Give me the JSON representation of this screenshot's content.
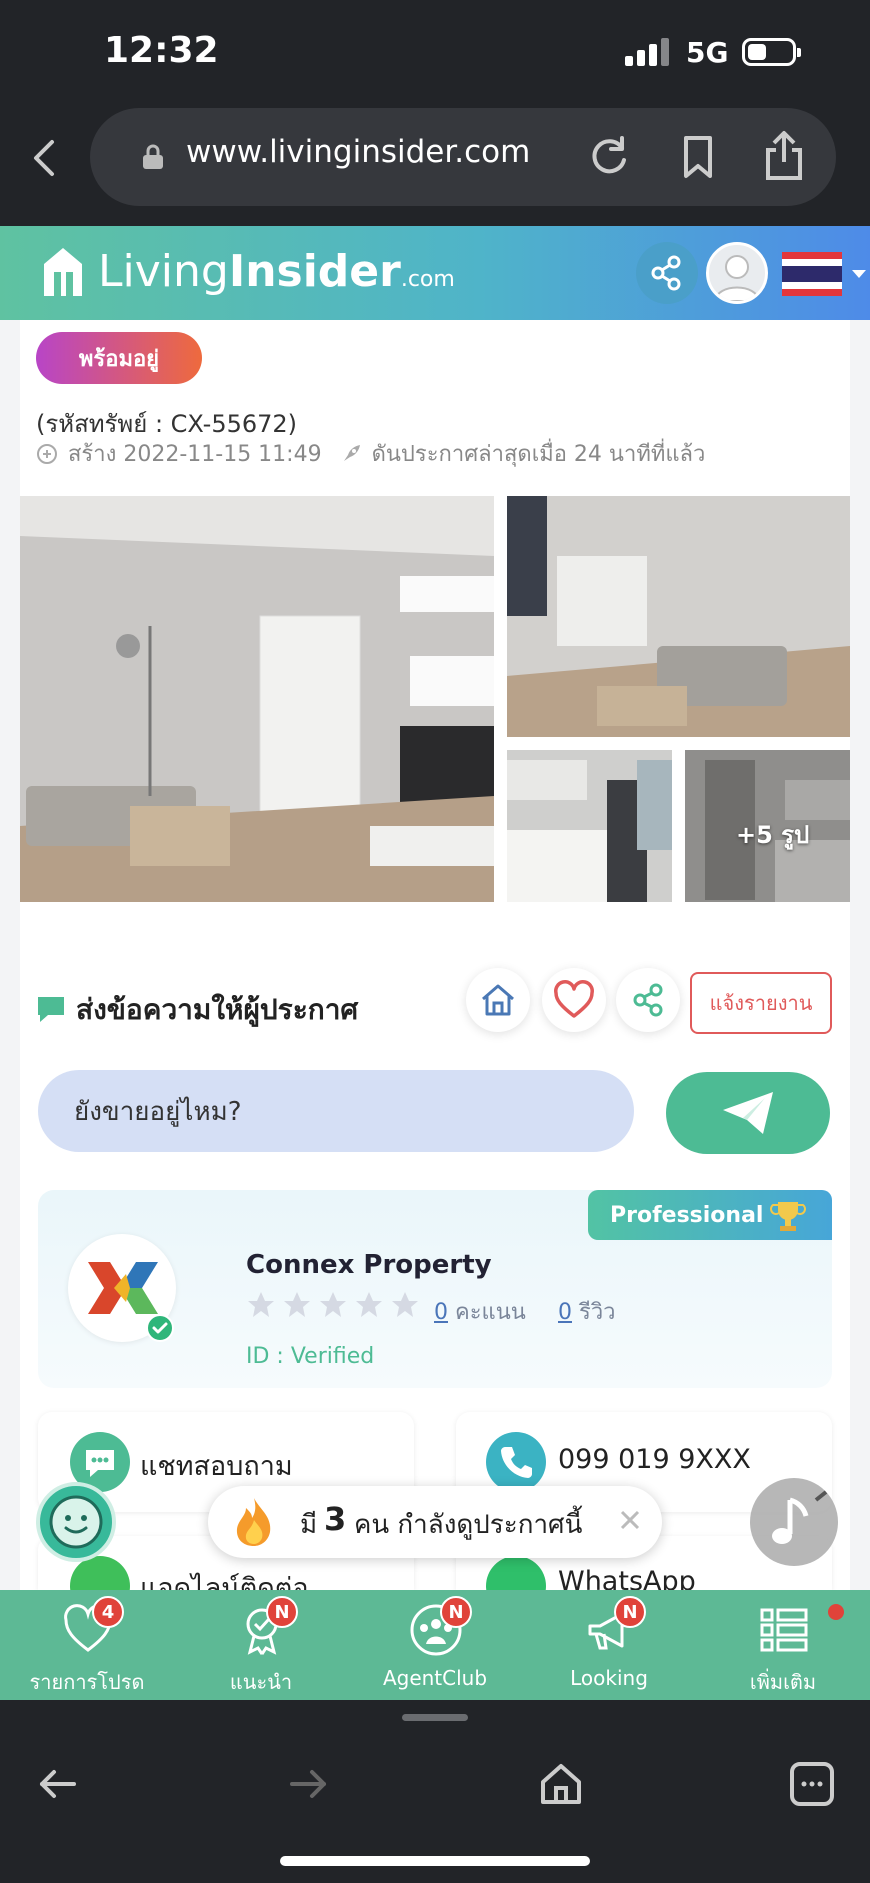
{
  "status": {
    "time": "12:32",
    "network": "5G"
  },
  "browser": {
    "url": "www.livinginsider.com"
  },
  "header": {
    "logo_living": "Living",
    "logo_insider": "Insider",
    "logo_domain": ".com"
  },
  "listing": {
    "badge": "พร้อมอยู่",
    "code": "(รหัสทรัพย์ : CX-55672)",
    "created": "สร้าง 2022-11-15 11:49",
    "bumped": "ดันประกาศล่าสุดเมื่อ 24 นาทีที่แล้ว",
    "more_photos": "+5 รูป"
  },
  "message": {
    "title": "ส่งข้อความให้ผู้ประกาศ",
    "report": "แจ้งรายงาน",
    "input_value": "ยังขายอยู่ไหม?"
  },
  "agent": {
    "badge": "Professional",
    "name": "Connex Property",
    "score_num": "0",
    "score_label": "คะแนน",
    "review_num": "0",
    "review_label": "รีวิว",
    "id_label": "ID : Verified",
    "rating": 0
  },
  "contacts": {
    "chat": "แชทสอบถาม",
    "phone": "099 019 9XXX",
    "line": "แอดไลน์ติดต่อ",
    "whatsapp": "WhatsApp"
  },
  "viewers": {
    "pre": "มี",
    "count": "3",
    "post": "คน กำลังดูประกาศนี้"
  },
  "nav": {
    "items": [
      {
        "label": "รายการโปรด",
        "badge": "4",
        "icon": "heart-icon"
      },
      {
        "label": "แนะนำ",
        "badge": "N",
        "icon": "award-icon"
      },
      {
        "label": "AgentClub",
        "badge": "N",
        "icon": "group-icon"
      },
      {
        "label": "Looking",
        "badge": "N",
        "icon": "megaphone-icon"
      },
      {
        "label": "เพิ่มเติม",
        "badge": "",
        "icon": "menu-list-icon"
      }
    ]
  },
  "colors": {
    "brand_green": "#5db995",
    "accent_red": "#e05a5a",
    "header_gradient_end": "#4e8be8"
  }
}
